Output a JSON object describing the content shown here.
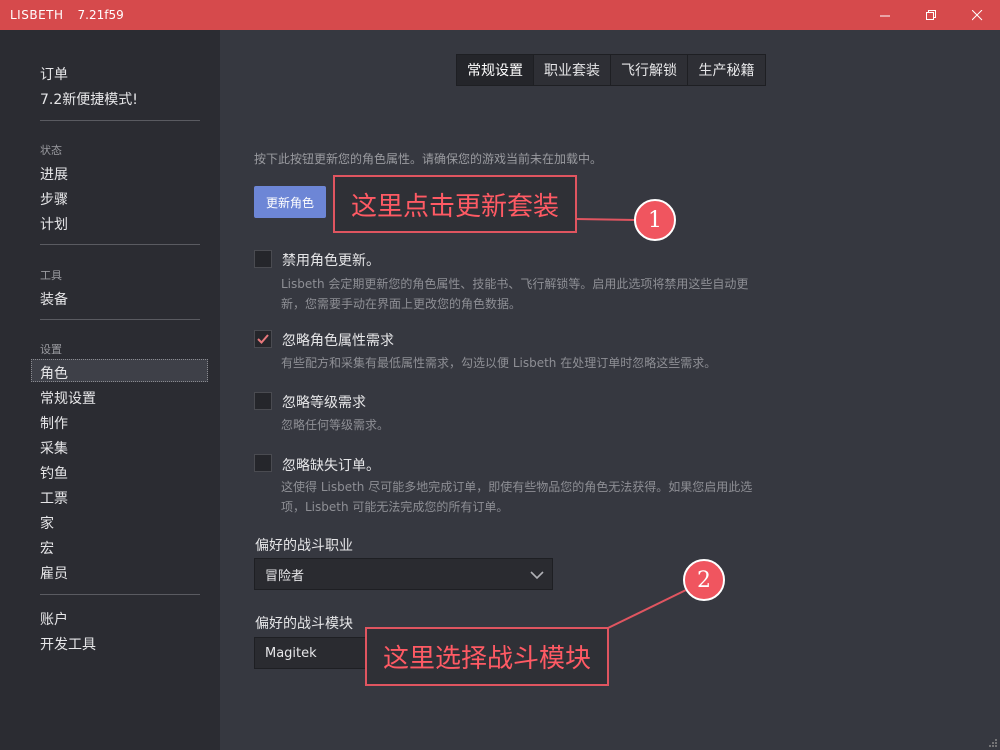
{
  "titlebar": {
    "app_name": "LISBETH",
    "version": "7.21f59",
    "minimize": "—",
    "maximize": "▫",
    "close": "✕"
  },
  "sidebar": {
    "top_items": [
      "订单",
      "7.2新便捷模式!"
    ],
    "status_header": "状态",
    "status_items": [
      "进展",
      "步骤",
      "计划"
    ],
    "tools_header": "工具",
    "tools_items": [
      "装备"
    ],
    "settings_header": "设置",
    "settings_items": [
      "角色",
      "常规设置",
      "制作",
      "采集",
      "钓鱼",
      "工票",
      "家",
      "宏",
      "雇员"
    ],
    "bottom_items": [
      "账户",
      "开发工具"
    ]
  },
  "tabs": [
    "常规设置",
    "职业套装",
    "飞行解锁",
    "生产秘籍"
  ],
  "main": {
    "intro": "按下此按钮更新您的角色属性。请确保您的游戏当前未在加载中。",
    "update_button": "更新角色",
    "options": [
      {
        "title": "禁用角色更新。",
        "desc": "Lisbeth 会定期更新您的角色属性、技能书、飞行解锁等。启用此选项将禁用这些自动更新，您需要手动在界面上更改您的角色数据。",
        "checked": false
      },
      {
        "title": "忽略角色属性需求",
        "desc": "有些配方和采集有最低属性需求，勾选以便 Lisbeth 在处理订单时忽略这些需求。",
        "checked": true
      },
      {
        "title": "忽略等级需求",
        "desc": "忽略任何等级需求。",
        "checked": false
      },
      {
        "title": "忽略缺失订单。",
        "desc": "这使得 Lisbeth 尽可能多地完成订单，即使有些物品您的角色无法获得。如果您启用此选项，Lisbeth 可能无法完成您的所有订单。",
        "checked": false
      }
    ],
    "combat_job_label": "偏好的战斗职业",
    "combat_job_value": "冒险者",
    "combat_module_label": "偏好的战斗模块",
    "combat_module_value": "Magitek"
  },
  "annotations": {
    "callout1": "这里点击更新套装",
    "badge1": "1",
    "callout2": "这里选择战斗模块",
    "badge2": "2"
  },
  "colors": {
    "titlebar": "#d64a4c",
    "accent_button": "#6d86d6",
    "annotation": "#f0555f",
    "check": "#e8787c"
  }
}
